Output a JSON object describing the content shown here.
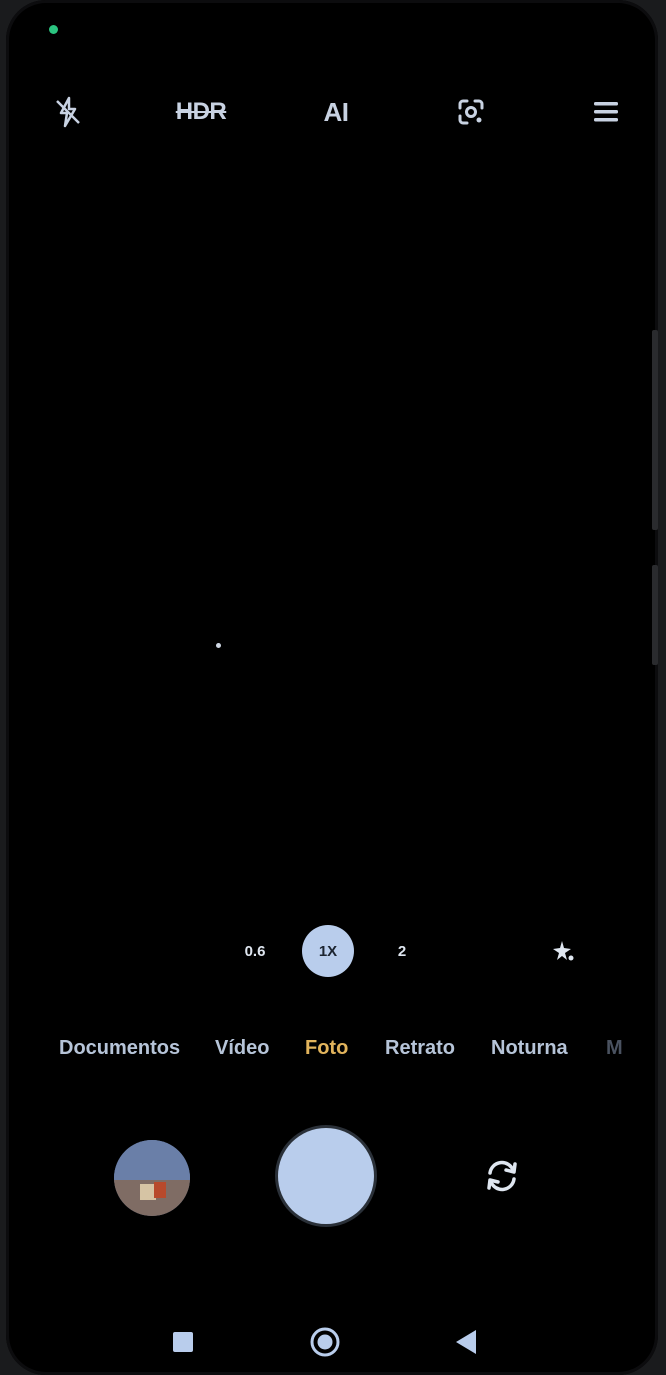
{
  "topbar": {
    "flash_icon": "flash-off-icon",
    "hdr_label": "HDR",
    "ai_label": "AI",
    "lens_icon": "google-lens-icon",
    "menu_icon": "hamburger-menu-icon"
  },
  "zoom": {
    "options": [
      "0.6",
      "1X",
      "2"
    ],
    "selected": "1X",
    "beauty_icon": "sparkle-filter-icon"
  },
  "modes": {
    "items": [
      "Documentos",
      "Vídeo",
      "Foto",
      "Retrato",
      "Noturna",
      "M"
    ],
    "selected": "Foto"
  },
  "controls": {
    "gallery_icon": "gallery-thumbnail",
    "shutter_icon": "shutter-button",
    "flip_icon": "switch-camera-icon"
  },
  "navbar": {
    "recents_icon": "recents-square-icon",
    "home_icon": "home-circle-icon",
    "back_icon": "back-triangle-icon"
  },
  "colors": {
    "accent_selected_mode": "#e2b45c",
    "shutter": "#b9cdec",
    "status_dot": "#2bc480"
  }
}
